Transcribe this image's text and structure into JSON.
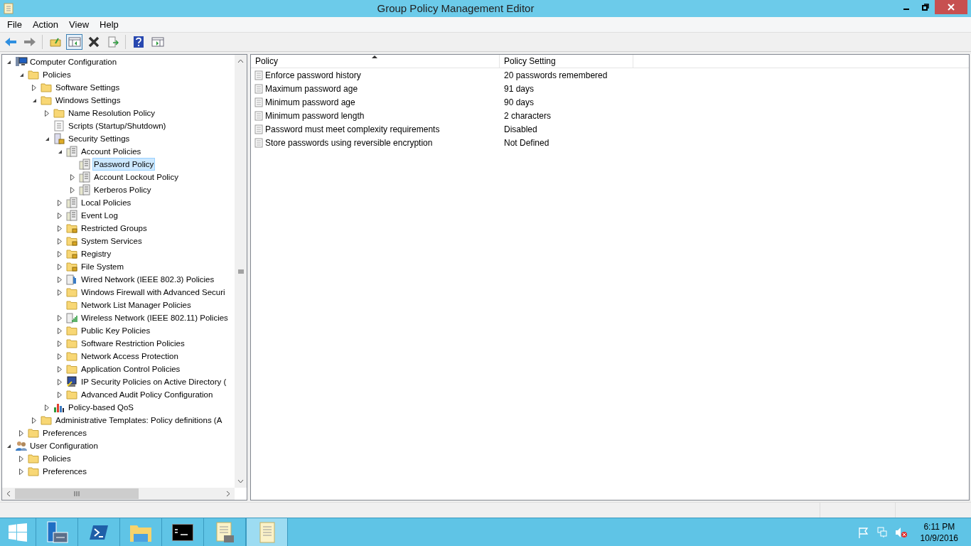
{
  "window": {
    "title": "Group Policy Management Editor"
  },
  "menu": [
    "File",
    "Action",
    "View",
    "Help"
  ],
  "toolbar": [
    {
      "kind": "back",
      "selected": false
    },
    {
      "kind": "forward",
      "selected": false
    },
    {
      "kind": "up",
      "selected": false
    },
    {
      "kind": "show-tree",
      "selected": true
    },
    {
      "kind": "delete",
      "selected": false
    },
    {
      "kind": "export",
      "selected": false
    },
    {
      "kind": "help",
      "selected": false
    },
    {
      "kind": "show-action",
      "selected": false
    }
  ],
  "tree": [
    {
      "label": "Computer Configuration",
      "kind": "computer",
      "expanded": true,
      "selected": false,
      "children": [
        {
          "label": "Policies",
          "kind": "folder",
          "expanded": true,
          "selected": false,
          "children": [
            {
              "label": "Software Settings",
              "kind": "folder",
              "expanded": false,
              "selected": false
            },
            {
              "label": "Windows Settings",
              "kind": "folder",
              "expanded": true,
              "selected": false,
              "children": [
                {
                  "label": "Name Resolution Policy",
                  "kind": "folder",
                  "expanded": false,
                  "selected": false
                },
                {
                  "label": "Scripts (Startup/Shutdown)",
                  "kind": "script",
                  "selected": false
                },
                {
                  "label": "Security Settings",
                  "kind": "security",
                  "expanded": true,
                  "selected": false,
                  "children": [
                    {
                      "label": "Account Policies",
                      "kind": "policy",
                      "expanded": true,
                      "selected": false,
                      "children": [
                        {
                          "label": "Password Policy",
                          "kind": "policy",
                          "selected": true
                        },
                        {
                          "label": "Account Lockout Policy",
                          "kind": "policy",
                          "expanded": false,
                          "selected": false
                        },
                        {
                          "label": "Kerberos Policy",
                          "kind": "policy",
                          "expanded": false,
                          "selected": false
                        }
                      ]
                    },
                    {
                      "label": "Local Policies",
                      "kind": "policy",
                      "expanded": false,
                      "selected": false
                    },
                    {
                      "label": "Event Log",
                      "kind": "policy",
                      "expanded": false,
                      "selected": false
                    },
                    {
                      "label": "Restricted Groups",
                      "kind": "lock-folder",
                      "expanded": false,
                      "selected": false
                    },
                    {
                      "label": "System Services",
                      "kind": "lock-folder",
                      "expanded": false,
                      "selected": false
                    },
                    {
                      "label": "Registry",
                      "kind": "lock-folder",
                      "expanded": false,
                      "selected": false
                    },
                    {
                      "label": "File System",
                      "kind": "lock-folder",
                      "expanded": false,
                      "selected": false
                    },
                    {
                      "label": "Wired Network (IEEE 802.3) Policies",
                      "kind": "wired",
                      "expanded": false,
                      "selected": false
                    },
                    {
                      "label": "Windows Firewall with Advanced Securi",
                      "kind": "folder",
                      "expanded": false,
                      "selected": false
                    },
                    {
                      "label": "Network List Manager Policies",
                      "kind": "folder",
                      "selected": false
                    },
                    {
                      "label": "Wireless Network (IEEE 802.11) Policies",
                      "kind": "wireless",
                      "expanded": false,
                      "selected": false
                    },
                    {
                      "label": "Public Key Policies",
                      "kind": "folder",
                      "expanded": false,
                      "selected": false
                    },
                    {
                      "label": "Software Restriction Policies",
                      "kind": "folder",
                      "expanded": false,
                      "selected": false
                    },
                    {
                      "label": "Network Access Protection",
                      "kind": "folder",
                      "expanded": false,
                      "selected": false
                    },
                    {
                      "label": "Application Control Policies",
                      "kind": "folder",
                      "expanded": false,
                      "selected": false
                    },
                    {
                      "label": "IP Security Policies on Active Directory (",
                      "kind": "ipsec",
                      "expanded": false,
                      "selected": false
                    },
                    {
                      "label": "Advanced Audit Policy Configuration",
                      "kind": "folder",
                      "expanded": false,
                      "selected": false
                    }
                  ]
                },
                {
                  "label": "Policy-based QoS",
                  "kind": "qos",
                  "expanded": false,
                  "selected": false
                }
              ]
            },
            {
              "label": "Administrative Templates: Policy definitions (A",
              "kind": "folder",
              "expanded": false,
              "selected": false
            }
          ]
        },
        {
          "label": "Preferences",
          "kind": "folder",
          "expanded": false,
          "selected": false
        }
      ]
    },
    {
      "label": "User Configuration",
      "kind": "user",
      "expanded": true,
      "selected": false,
      "children": [
        {
          "label": "Policies",
          "kind": "folder",
          "expanded": false,
          "selected": false
        },
        {
          "label": "Preferences",
          "kind": "folder",
          "expanded": false,
          "selected": false
        }
      ]
    }
  ],
  "table": {
    "columns": [
      "Policy",
      "Policy Setting"
    ],
    "rows": [
      {
        "policy": "Enforce password history",
        "setting": "20 passwords remembered"
      },
      {
        "policy": "Maximum password age",
        "setting": "91 days"
      },
      {
        "policy": "Minimum password age",
        "setting": "90 days"
      },
      {
        "policy": "Minimum password length",
        "setting": "2 characters"
      },
      {
        "policy": "Password must meet complexity requirements",
        "setting": "Disabled"
      },
      {
        "policy": "Store passwords using reversible encryption",
        "setting": "Not Defined"
      }
    ]
  },
  "taskbar": {
    "apps": [
      {
        "kind": "server-manager",
        "selected": false
      },
      {
        "kind": "powershell",
        "selected": false
      },
      {
        "kind": "explorer",
        "selected": false
      },
      {
        "kind": "cmd",
        "selected": false
      },
      {
        "kind": "gpm",
        "selected": false
      },
      {
        "kind": "editor",
        "selected": true
      }
    ],
    "time": "6:11 PM",
    "date": "10/9/2016"
  }
}
